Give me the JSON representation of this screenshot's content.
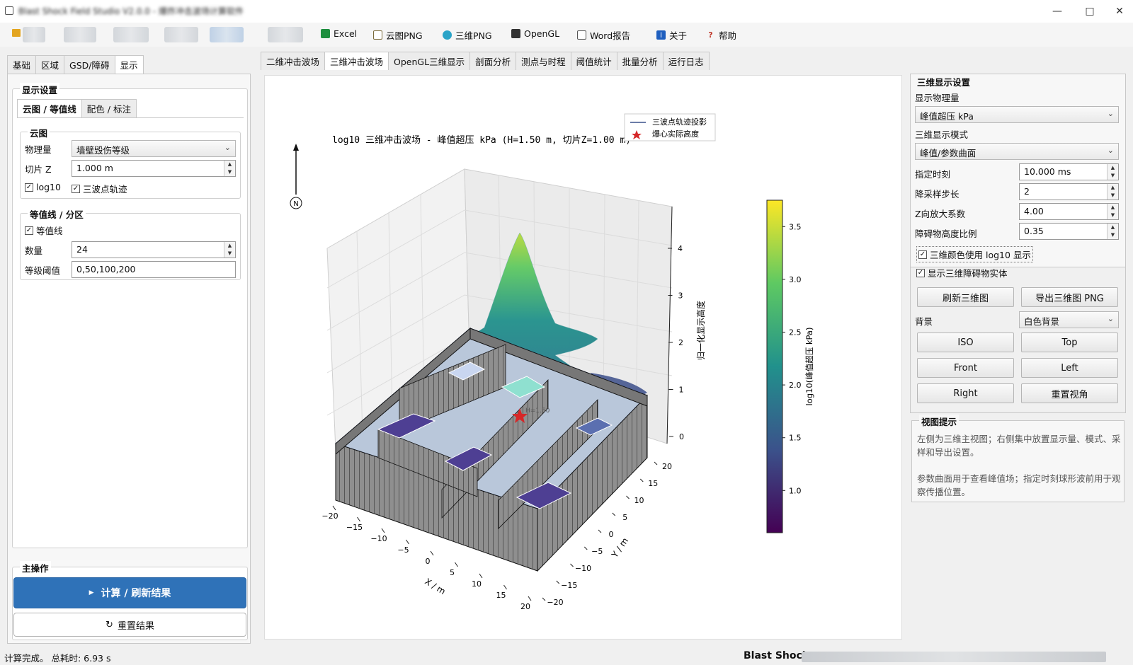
{
  "window": {
    "title": "Blast Shock Field Studio V2.0.0 - 爆炸冲击波场计算软件",
    "minimize_icon": "minimize-icon",
    "maximize_icon": "maximize-icon",
    "close_icon": "close-icon"
  },
  "toolbar": {
    "items": [
      {
        "label": "Excel",
        "icon": "excel-icon",
        "color": "#1e8e3e"
      },
      {
        "label": "云图PNG",
        "icon": "image-icon",
        "color": "#7a6a3a"
      },
      {
        "label": "三维PNG",
        "icon": "globe-icon",
        "color": "#2aa4c8"
      },
      {
        "label": "OpenGL",
        "icon": "monitor-icon",
        "color": "#333333"
      },
      {
        "label": "Word报告",
        "icon": "document-icon",
        "color": "#555555"
      },
      {
        "label": "关于",
        "icon": "info-icon",
        "color": "#1f5fbf"
      },
      {
        "label": "帮助",
        "icon": "help-icon",
        "color": "#c0392b"
      }
    ]
  },
  "left": {
    "tabs": [
      "基础",
      "区域",
      "GSD/障碍",
      "显示"
    ],
    "active_tab": 3,
    "display_group_title": "显示设置",
    "subtabs": [
      "云图 / 等值线",
      "配色 / 标注"
    ],
    "cloud_group": {
      "title": "云图",
      "quantity_label": "物理量",
      "quantity_value": "墙壁毁伤等级",
      "slice_label": "切片 Z",
      "slice_value": "1.000 m",
      "log10_label": "log10",
      "log10_checked": true,
      "trajectory_label": "三波点轨迹",
      "trajectory_checked": true
    },
    "contour_group": {
      "title": "等值线 / 分区",
      "contour_label": "等值线",
      "contour_checked": true,
      "count_label": "数量",
      "count_value": "24",
      "threshold_label": "等级阈值",
      "threshold_value": "0,50,100,200"
    },
    "main_ops": {
      "title": "主操作",
      "compute_label": "计算 / 刷新结果",
      "reset_label": "重置结果"
    }
  },
  "center": {
    "tabs": [
      "二维冲击波场",
      "三维冲击波场",
      "OpenGL三维显示",
      "剖面分析",
      "测点与时程",
      "阈值统计",
      "批量分析",
      "运行日志"
    ],
    "active_tab": 1,
    "plot": {
      "title": "log10 三维冲击波场 - 峰值超压 kPa (H=1.50 m, 切片Z=1.00 m)",
      "legend": [
        "三波点轨迹投影",
        "爆心实际高度"
      ],
      "xlabel": "X / m",
      "ylabel": "Y / m",
      "zlabel": "归一化显示高度",
      "north": "N",
      "burst_label": "H=1.50",
      "x_ticks": [
        "−20",
        "−15",
        "−10",
        "−5",
        "0",
        "5",
        "10",
        "15",
        "20"
      ],
      "y_ticks": [
        "−20",
        "−15",
        "−10",
        "−5",
        "0",
        "5",
        "10",
        "15",
        "20"
      ],
      "z_ticks": [
        "0",
        "1",
        "2",
        "3",
        "4"
      ],
      "colorbar_label": "log10(峰值超压 kPa)",
      "colorbar_ticks": [
        "1.0",
        "1.5",
        "2.0",
        "2.5",
        "3.0",
        "3.5"
      ],
      "colorbar_range": [
        0.6,
        3.75
      ],
      "colormap": [
        "#440154",
        "#3b528b",
        "#21918c",
        "#5ec962",
        "#fde725"
      ]
    }
  },
  "right": {
    "settings_title": "三维显示设置",
    "quantity_label": "显示物理量",
    "quantity_value": "峰值超压 kPa",
    "mode_label": "三维显示模式",
    "mode_value": "峰值/参数曲面",
    "time_label": "指定时刻",
    "time_value": "10.000 ms",
    "step_label": "降采样步长",
    "step_value": "2",
    "zscale_label": "Z向放大系数",
    "zscale_value": "4.00",
    "obst_label": "障碍物高度比例",
    "obst_value": "0.35",
    "log_color_label": "三维颜色使用 log10 显示",
    "log_color_checked": true,
    "show_obst_label": "显示三维障碍物实体",
    "show_obst_checked": true,
    "refresh_label": "刷新三维图",
    "export_label": "导出三维图 PNG",
    "bg_label": "背景",
    "bg_value": "白色背景",
    "views": [
      "ISO",
      "Top",
      "Front",
      "Left",
      "Right",
      "重置视角"
    ],
    "hint_title": "视图提示",
    "hint_p1": "左侧为三维主视图；右侧集中放置显示量、模式、采样和导出设置。",
    "hint_p2": "参数曲面用于查看峰值场；指定时刻球形波前用于观察传播位置。"
  },
  "status": {
    "left": "计算完成。 总耗时: 6.93 s",
    "right": "Blast Shock"
  }
}
